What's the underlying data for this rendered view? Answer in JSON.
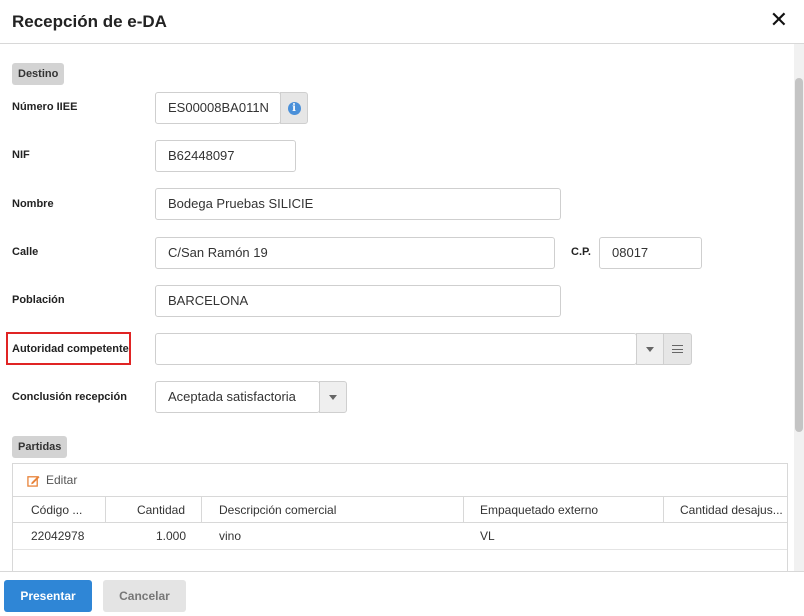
{
  "dialog": {
    "title": "Recepción de e-DA",
    "close_glyph": "✕"
  },
  "destino": {
    "section_label": "Destino",
    "numero_iiee": {
      "label": "Número IIEE",
      "value": "ES00008BA011N",
      "info_icon": "i"
    },
    "nif": {
      "label": "NIF",
      "value": "B62448097"
    },
    "nombre": {
      "label": "Nombre",
      "value": "Bodega Pruebas SILICIE"
    },
    "calle": {
      "label": "Calle",
      "value": "C/San Ramón 19"
    },
    "cp": {
      "label": "C.P.",
      "value": "08017"
    },
    "poblacion": {
      "label": "Población",
      "value": "BARCELONA"
    },
    "autoridad": {
      "label": "Autoridad competente",
      "value": ""
    },
    "conclusion": {
      "label": "Conclusión recepción",
      "value": "Aceptada satisfactoria"
    }
  },
  "partidas": {
    "section_label": "Partidas",
    "edit_label": "Editar",
    "columns": [
      "Código ...",
      "Cantidad",
      "Descripción comercial",
      "Empaquetado externo",
      "Cantidad desajus..."
    ],
    "rows": [
      {
        "codigo": "22042978",
        "cantidad": "1.000",
        "descripcion": "vino",
        "empaquetado": "VL",
        "desajuste": ""
      }
    ]
  },
  "footer": {
    "submit_label": "Presentar",
    "cancel_label": "Cancelar"
  },
  "colors": {
    "primary": "#2f86d6",
    "highlight": "#e02424",
    "info": "#4a90d9",
    "edit_icon": "#e8833a"
  }
}
